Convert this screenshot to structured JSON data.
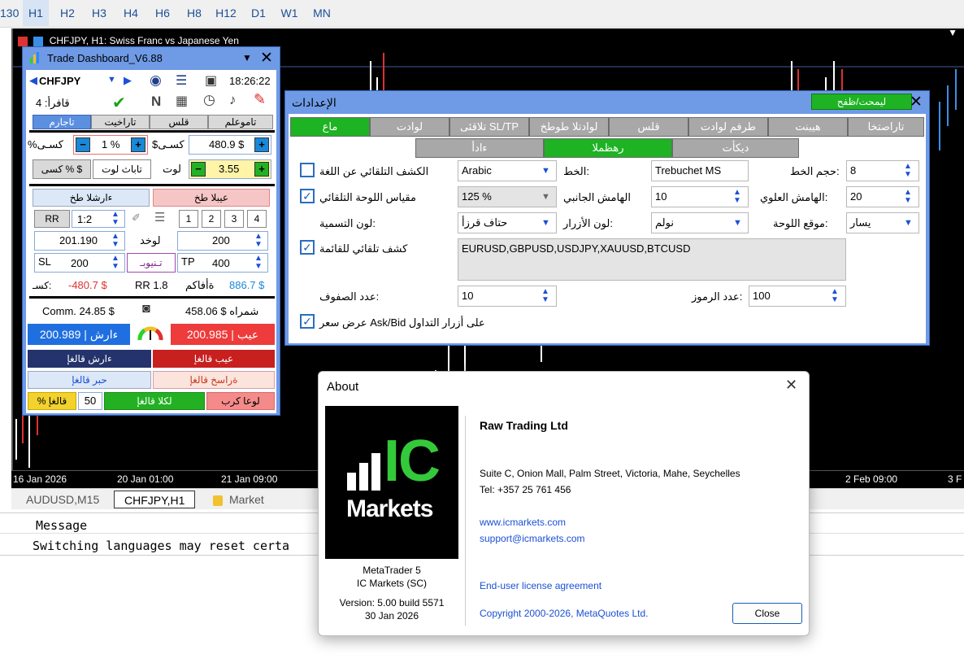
{
  "timeframes": [
    "130",
    "H1",
    "H2",
    "H3",
    "H4",
    "H6",
    "H8",
    "H12",
    "D1",
    "W1",
    "MN"
  ],
  "active_timeframe": "H1",
  "chart": {
    "symbol_caption": "CHFJPY, H1:  Swiss Franc vs Japanese Yen",
    "x_labels": [
      "16 Jan 2026",
      "20 Jan 01:00",
      "21 Jan 09:00",
      "2 Feb 09:00",
      "3 F"
    ]
  },
  "bottom_tabs": [
    "AUDUSD,M15",
    "CHFJPY,H1",
    "Market"
  ],
  "toolbox": {
    "header": "Message",
    "line": "Switching languages may reset certa"
  },
  "dashboard": {
    "title": "Trade Dashboard_V6.88",
    "symbol": "CHFJPY",
    "time": "18:26:22",
    "trades_label": "4 :قافرأ",
    "n_label": "N",
    "tabs": [
      "تاجارم",
      "تاراخيت",
      "قلس",
      "تاموعلم"
    ],
    "risk_label": "%كسـى",
    "risk_value": "1 %",
    "risk2_label": "$كسـى",
    "risk2_value": "480.9 $",
    "lot_label": "لوت",
    "lot_value": "3.55",
    "lot_fixed": "تاباث لوت",
    "pct_btn": "كسى % $",
    "buy_tab": "ءارشلا طخ",
    "sell_tab": "عيبلا طخ",
    "rr_btn": "RR",
    "rr_value": "1:2",
    "num_btns": [
      "1",
      "2",
      "3",
      "4"
    ],
    "entry_value": "201.190",
    "entry_label": "لوخد",
    "dist_value": "200",
    "sl_label": "SL",
    "sl_value": "200",
    "reset_btn": "تـنيوبـ",
    "tp_label": "TP",
    "tp_value": "400",
    "loss_label": "كسـ:",
    "loss_value": "-480.7 $",
    "rr_text": "RR 1.8",
    "profit_label": "ةأفاكم",
    "profit_value": "886.7 $",
    "comm_text": "Comm. 24.85 $",
    "spread_text": "458.06 $ شمراه",
    "buy_price": "200.989 | ءارش",
    "sell_price": "200.985 | عيب",
    "close_buy": "ءارش قالغإ",
    "close_sell": "عيب قالغإ",
    "close_profit": "حبر قالغإ",
    "close_loss": "ةراسخ قالغإ",
    "close_pct": "% قالغإ",
    "close_pct_value": "50",
    "close_all": "لكلا قالغإ",
    "breakeven": "لوعا كرب"
  },
  "settings": {
    "title": "الإعدادات",
    "save_btn": "ليمحت/ظفح",
    "tabs_row1": [
      "ماع",
      "لوادت",
      "تلاقئى SL/TP",
      "لوادتلا طوطخ",
      "قلس",
      "طرفم لوادت",
      "هيبنت",
      "تاراصتخا"
    ],
    "tabs_row2": [
      "ءادأ",
      "رهظملا",
      "ديكأت"
    ],
    "auto_detect_label": "الكشف التلقائي عن اللغة",
    "language_value": "Arabic",
    "font_label": "الخط:",
    "font_value": "Trebuchet MS",
    "font_size_label": "حجم الخط:",
    "font_size_value": "8",
    "auto_scale_label": "مقياس اللوحة التلقائي",
    "scale_value": "125 %",
    "side_margin_label": "الهامش الجانبي",
    "side_margin_value": "10",
    "top_margin_label": "الهامش العلوي:",
    "top_margin_value": "20",
    "label_color_label": "لون التسمية:",
    "label_color_value": "حتاف قرزأ",
    "btn_color_label": "لون الأزرار:",
    "btn_color_value": "نولم",
    "panel_pos_label": "موقع اللوحة:",
    "panel_pos_value": "يسار",
    "symbols_label": "كشف تلقائي للقائمة",
    "symbols_value": "EURUSD,GBPUSD,USDJPY,XAUUSD,BTCUSD",
    "rows_label": "عدد الصفوف:",
    "rows_value": "10",
    "symbols_count_label": "عدد الرموز:",
    "symbols_count_value": "100",
    "ask_bid_label": "عرض سعر Ask/Bid على أزرار التداول"
  },
  "about": {
    "title": "About",
    "logo_big": "IC",
    "logo_small": "Markets",
    "product": "MetaTrader 5",
    "company_short": "IC Markets (SC)",
    "version": "Version: 5.00 build 5571",
    "date": "30 Jan 2026",
    "company": "Raw Trading Ltd",
    "address": "Suite C, Onion Mall, Palm Street, Victoria, Mahe, Seychelles",
    "tel": "Tel: +357 25 761 456",
    "website": "www.icmarkets.com",
    "email": "support@icmarkets.com",
    "eula": "End-user license agreement",
    "copyright": "Copyright 2000-2026, MetaQuotes Ltd.",
    "close_btn": "Close"
  },
  "colors": {
    "green": "#1db323",
    "blue_frame": "#6f9ae6",
    "link": "#1a4fd6"
  }
}
